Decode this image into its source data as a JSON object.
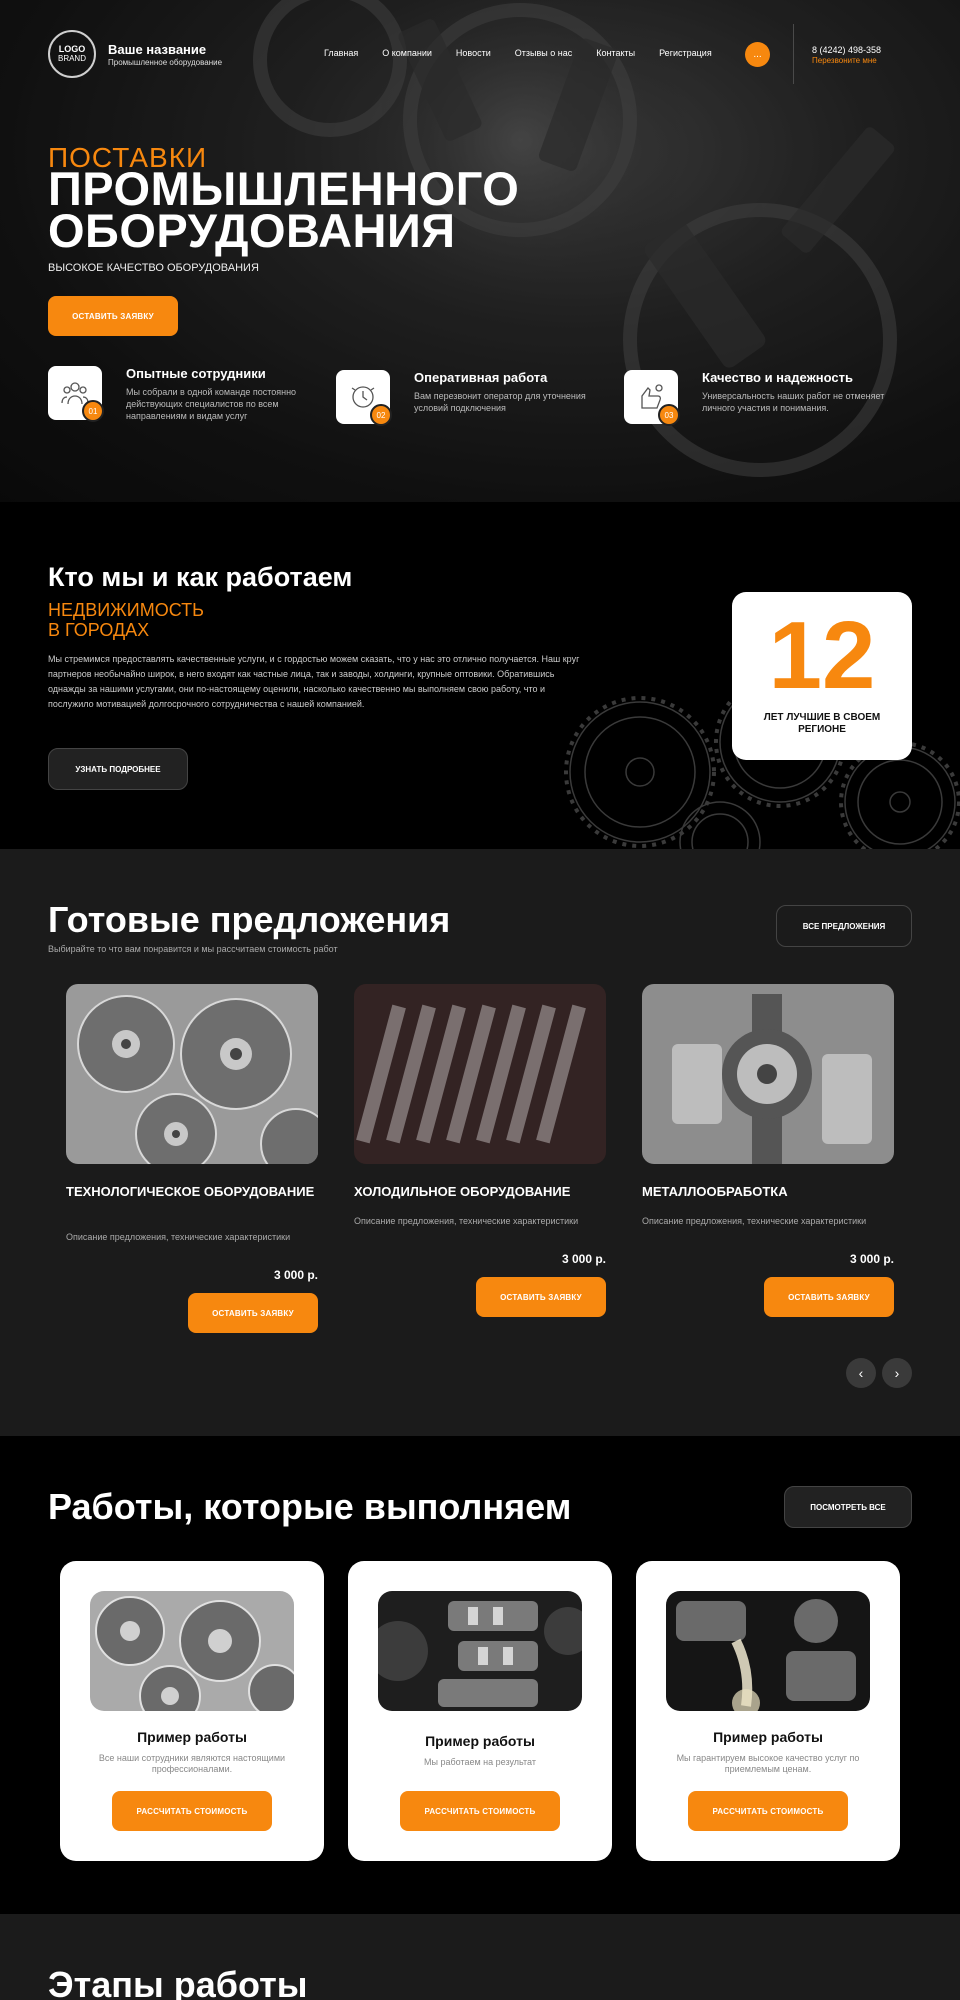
{
  "header": {
    "logo_line1": "LOGO",
    "logo_line2": "BRAND",
    "brand_name": "Ваше название",
    "brand_sub": "Промышленное оборудование",
    "nav": [
      "Главная",
      "О компании",
      "Новости",
      "Отзывы о нас",
      "Контакты",
      "Регистрация"
    ],
    "more_label": "...",
    "phone": "8 (4242) 498-358",
    "callback": "Перезвоните мне"
  },
  "hero": {
    "kicker": "ПОСТАВКИ",
    "title_line1": "ПРОМЫШЛЕННОГО",
    "title_line2": "ОБОРУДОВАНИЯ",
    "subtitle": "ВЫСОКОЕ КАЧЕСТВО ОБОРУДОВАНИЯ",
    "button": "ОСТАВИТЬ ЗАЯВКУ",
    "features": [
      {
        "num": "01",
        "title": "Опытные сотрудники",
        "text": "Мы собрали в одной команде постоянно действующих специалистов по всем направлениям и видам услуг",
        "icon": "team-icon"
      },
      {
        "num": "02",
        "title": "Оперативная работа",
        "text": "Вам перезвонит оператор для уточнения условий подключения",
        "icon": "clock-icon"
      },
      {
        "num": "03",
        "title": "Качество и надежность",
        "text": "Универсальность наших работ не отменяет личного участия и понимания.",
        "icon": "quality-icon"
      }
    ]
  },
  "about": {
    "title": "Кто мы и как работаем",
    "sub_line1": "НЕДВИЖИМОСТЬ",
    "sub_line2": "В ГОРОДАХ",
    "text": "Мы стремимся предоставлять качественные услуги, и с гордостью можем сказать, что у нас это отлично получается. Наш круг партнеров необычайно широк, в него входят как частные лица, так и заводы, холдинги, крупные оптовики. Обратившись однажды за нашими услугами, они по-настоящему оценили, насколько качественно мы выполняем свою работу, что и послужило мотивацией долгосрочного сотрудничества с нашей компанией.",
    "button": "УЗНАТЬ ПОДРОБНЕЕ",
    "stat_number": "12",
    "stat_label": "ЛЕТ ЛУЧШИЕ В СВОЕМ РЕГИОНЕ"
  },
  "offers": {
    "title": "Готовые предложения",
    "subtitle": "Выбирайте то что вам понравится и мы рассчитаем стоимость работ",
    "all_button": "ВСЕ ПРЕДЛОЖЕНИЯ",
    "items": [
      {
        "title": "ТЕХНОЛОГИЧЕСКОЕ ОБОРУДОВАНИЕ",
        "desc": "Описание предложения, технические характеристики",
        "price": "3 000 р.",
        "button": "ОСТАВИТЬ ЗАЯВКУ"
      },
      {
        "title": "ХОЛОДИЛЬНОЕ ОБОРУДОВАНИЕ",
        "desc": "Описание предложения, технические характеристики",
        "price": "3 000 р.",
        "button": "ОСТАВИТЬ ЗАЯВКУ"
      },
      {
        "title": "МЕТАЛЛООБРАБОТКА",
        "desc": "Описание предложения, технические характеристики",
        "price": "3 000 р.",
        "button": "ОСТАВИТЬ ЗАЯВКУ"
      }
    ],
    "prev_icon": "‹",
    "next_icon": "›"
  },
  "works": {
    "title": "Работы,  которые выполняем",
    "all_button": "ПОСМОТРЕТЬ ВСЕ",
    "items": [
      {
        "title": "Пример работы",
        "text": "Все наши сотрудники являются настоящими профессионалами.",
        "button": "РАССЧИТАТЬ СТОИМОСТЬ"
      },
      {
        "title": "Пример работы",
        "text": "Мы работаем на результат",
        "button": "РАССЧИТАТЬ СТОИМОСТЬ"
      },
      {
        "title": "Пример работы",
        "text": "Мы гарантируем высокое качество услуг по приемлемым ценам.",
        "button": "РАССЧИТАТЬ СТОИМОСТЬ"
      }
    ]
  },
  "stages": {
    "title": "Этапы работы"
  },
  "colors": {
    "accent": "#f7880f",
    "dark": "#000000",
    "section_gray": "#1b1b1b"
  }
}
